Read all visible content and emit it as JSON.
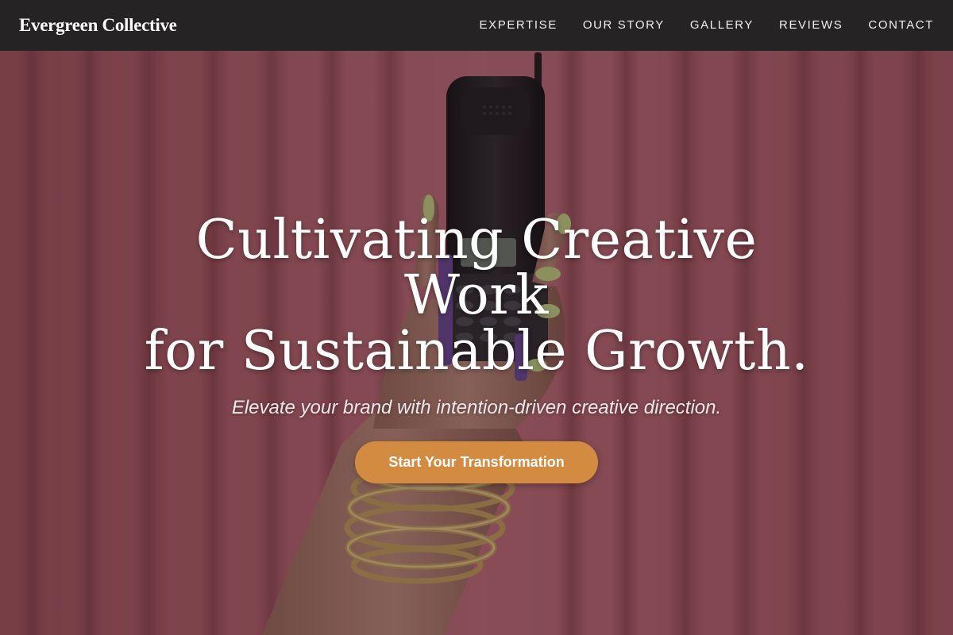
{
  "nav": {
    "brand": "Evergreen Collective",
    "links": [
      {
        "label": "EXPERTISE"
      },
      {
        "label": "OUR STORY"
      },
      {
        "label": "GALLERY"
      },
      {
        "label": "REVIEWS"
      },
      {
        "label": "CONTACT"
      }
    ]
  },
  "hero": {
    "title_line_1": "Cultivating Creative Work",
    "title_line_2": "for Sustainable Growth.",
    "subtitle": "Elevate your brand with intention-driven creative direction.",
    "cta_label": "Start Your Transformation",
    "background_image": "hand-holding-phone-curtain-photo"
  },
  "colors": {
    "nav_background": "#262324",
    "cta_background": "#d38b42",
    "curtain": "#b9666f",
    "text": "#ffffff"
  }
}
